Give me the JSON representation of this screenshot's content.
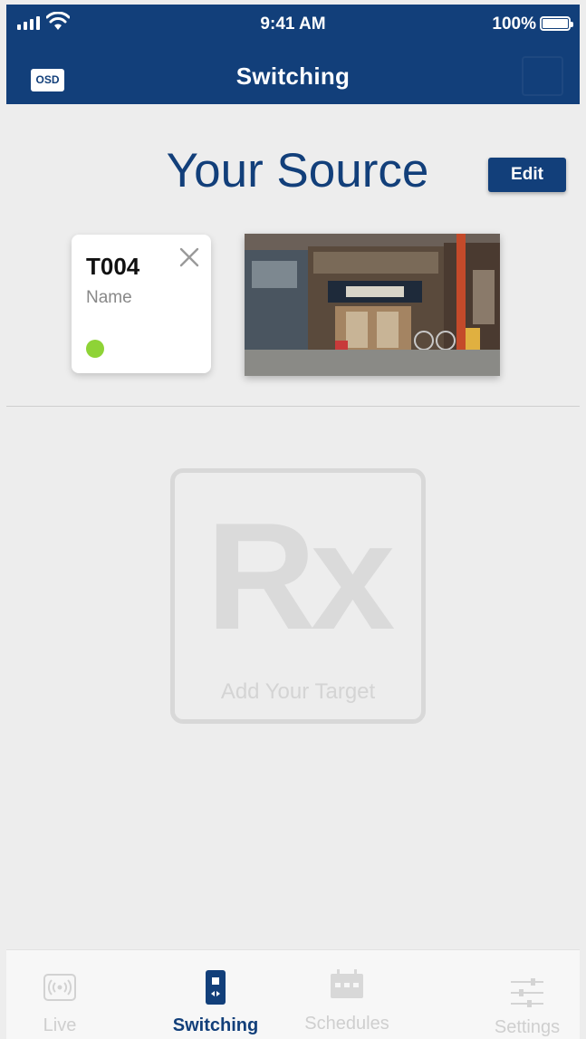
{
  "status_bar": {
    "time": "9:41 AM",
    "battery": "100%"
  },
  "nav": {
    "badge": "OSD",
    "title": "Switching"
  },
  "source": {
    "heading": "Your Source",
    "edit_label": "Edit",
    "card": {
      "id": "T004",
      "name": "Name",
      "status_color": "#8ed336"
    }
  },
  "target": {
    "placeholder_text": "Rx",
    "label": "Add Your Target"
  },
  "tabs": [
    {
      "label": "Live",
      "icon": "broadcast-icon",
      "active": false
    },
    {
      "label": "Switching",
      "icon": "switching-device-icon",
      "active": true
    },
    {
      "label": "Schedules",
      "icon": "calendar-icon",
      "active": false
    },
    {
      "label": "Settings",
      "icon": "sliders-icon",
      "active": false
    }
  ],
  "colors": {
    "brand": "#123f7a",
    "background": "#ededed",
    "online": "#8ed336",
    "inactive": "#cfcfcf"
  }
}
